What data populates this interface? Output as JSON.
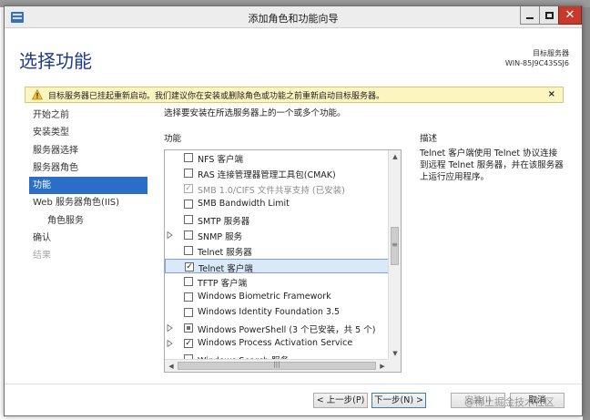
{
  "window": {
    "title": "添加角色和功能向导",
    "page_title": "选择功能",
    "destination_label": "目标服务器",
    "destination_server": "WIN-85J9C43SSJ6"
  },
  "warning": {
    "text": "目标服务器已挂起重新启动。我们建议你在安装或删除角色或功能之前重新启动目标服务器。",
    "close_glyph": "×"
  },
  "nav": {
    "items": [
      {
        "label": "开始之前",
        "state": "normal",
        "sub": false
      },
      {
        "label": "安装类型",
        "state": "normal",
        "sub": false
      },
      {
        "label": "服务器选择",
        "state": "normal",
        "sub": false
      },
      {
        "label": "服务器角色",
        "state": "normal",
        "sub": false
      },
      {
        "label": "功能",
        "state": "active",
        "sub": false
      },
      {
        "label": "Web 服务器角色(IIS)",
        "state": "normal",
        "sub": false
      },
      {
        "label": "角色服务",
        "state": "normal",
        "sub": true
      },
      {
        "label": "确认",
        "state": "normal",
        "sub": false
      },
      {
        "label": "结果",
        "state": "disabled",
        "sub": false
      }
    ]
  },
  "content": {
    "intro": "选择要安装在所选服务器上的一个或多个功能。",
    "features_header": "功能",
    "description_header": "描述",
    "description_text": "Telnet 客户端使用 Telnet 协议连接到远程 Telnet 服务器，并在该服务器上运行应用程序。"
  },
  "features": [
    {
      "label": "NFS 客户端",
      "checked": "none",
      "expandable": false,
      "grey": false,
      "selected": false
    },
    {
      "label": "RAS 连接管理器管理工具包(CMAK)",
      "checked": "none",
      "expandable": false,
      "grey": false,
      "selected": false
    },
    {
      "label": "SMB 1.0/CIFS 文件共享支持 (已安装)",
      "checked": "check",
      "expandable": false,
      "grey": true,
      "selected": false
    },
    {
      "label": "SMB Bandwidth Limit",
      "checked": "none",
      "expandable": false,
      "grey": false,
      "selected": false
    },
    {
      "label": "SMTP 服务器",
      "checked": "none",
      "expandable": false,
      "grey": false,
      "selected": false
    },
    {
      "label": "SNMP 服务",
      "checked": "none",
      "expandable": true,
      "grey": false,
      "selected": false
    },
    {
      "label": "Telnet 服务器",
      "checked": "none",
      "expandable": false,
      "grey": false,
      "selected": false
    },
    {
      "label": "Telnet 客户端",
      "checked": "check",
      "expandable": false,
      "grey": false,
      "selected": true
    },
    {
      "label": "TFTP 客户端",
      "checked": "none",
      "expandable": false,
      "grey": false,
      "selected": false
    },
    {
      "label": "Windows Biometric Framework",
      "checked": "none",
      "expandable": false,
      "grey": false,
      "selected": false
    },
    {
      "label": "Windows Identity Foundation 3.5",
      "checked": "none",
      "expandable": false,
      "grey": false,
      "selected": false
    },
    {
      "label": "Windows PowerShell (3 个已安装，共 5 个)",
      "checked": "partial",
      "expandable": true,
      "grey": false,
      "selected": false
    },
    {
      "label": "Windows Process Activation Service",
      "checked": "check",
      "expandable": true,
      "grey": false,
      "selected": false
    },
    {
      "label": "Windows Search 服务",
      "checked": "none",
      "expandable": false,
      "grey": false,
      "selected": false
    }
  ],
  "buttons": {
    "back": "< 上一步(P)",
    "next": "下一步(N) >",
    "install": "安装(I)",
    "cancel": "取消"
  },
  "watermark": "@稀土掘金技术社区",
  "colors": {
    "accent": "#2a6ec7",
    "title": "#1f3c88",
    "warning_bg": "#fdf5c0",
    "close": "#c7392c"
  }
}
